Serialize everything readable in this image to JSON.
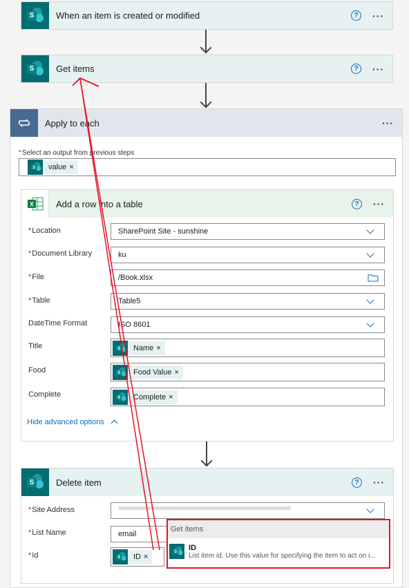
{
  "trigger": {
    "title": "When an item is created or modified",
    "help": "?",
    "more": "···"
  },
  "get_items": {
    "title": "Get items",
    "help": "?",
    "more": "···"
  },
  "apply_each": {
    "title": "Apply to each",
    "more": "···",
    "select_label": "Select an output from previous steps",
    "token": "value"
  },
  "add_row": {
    "title": "Add a row into a table",
    "help": "?",
    "more": "···",
    "fields": {
      "location_label": "Location",
      "location_value": "SharePoint Site - sunshine",
      "library_label": "Document Library",
      "library_value": "ku",
      "file_label": "File",
      "file_value": "/Book.xlsx",
      "table_label": "Table",
      "table_value": "Table5",
      "datetime_label": "DateTime Format",
      "datetime_value": "ISO 8601",
      "title_label": "Title",
      "title_token": "Name",
      "food_label": "Food",
      "food_token": "Food Value",
      "complete_label": "Complete",
      "complete_token": "Complete"
    },
    "hide_advanced": "Hide advanced options"
  },
  "delete_item": {
    "title": "Delete item",
    "help": "?",
    "more": "···",
    "site_label": "Site Address",
    "list_label": "List Name",
    "list_value": "email",
    "id_label": "Id",
    "id_token": "ID"
  },
  "popup": {
    "header": "Get items",
    "item_name": "ID",
    "item_desc": "List item id. Use this value for specifying the item to act on i..."
  },
  "token_remove": "×",
  "colors": {
    "annotation": "#e81123",
    "sharepoint": "#036c70",
    "link": "#0f6cbd"
  }
}
